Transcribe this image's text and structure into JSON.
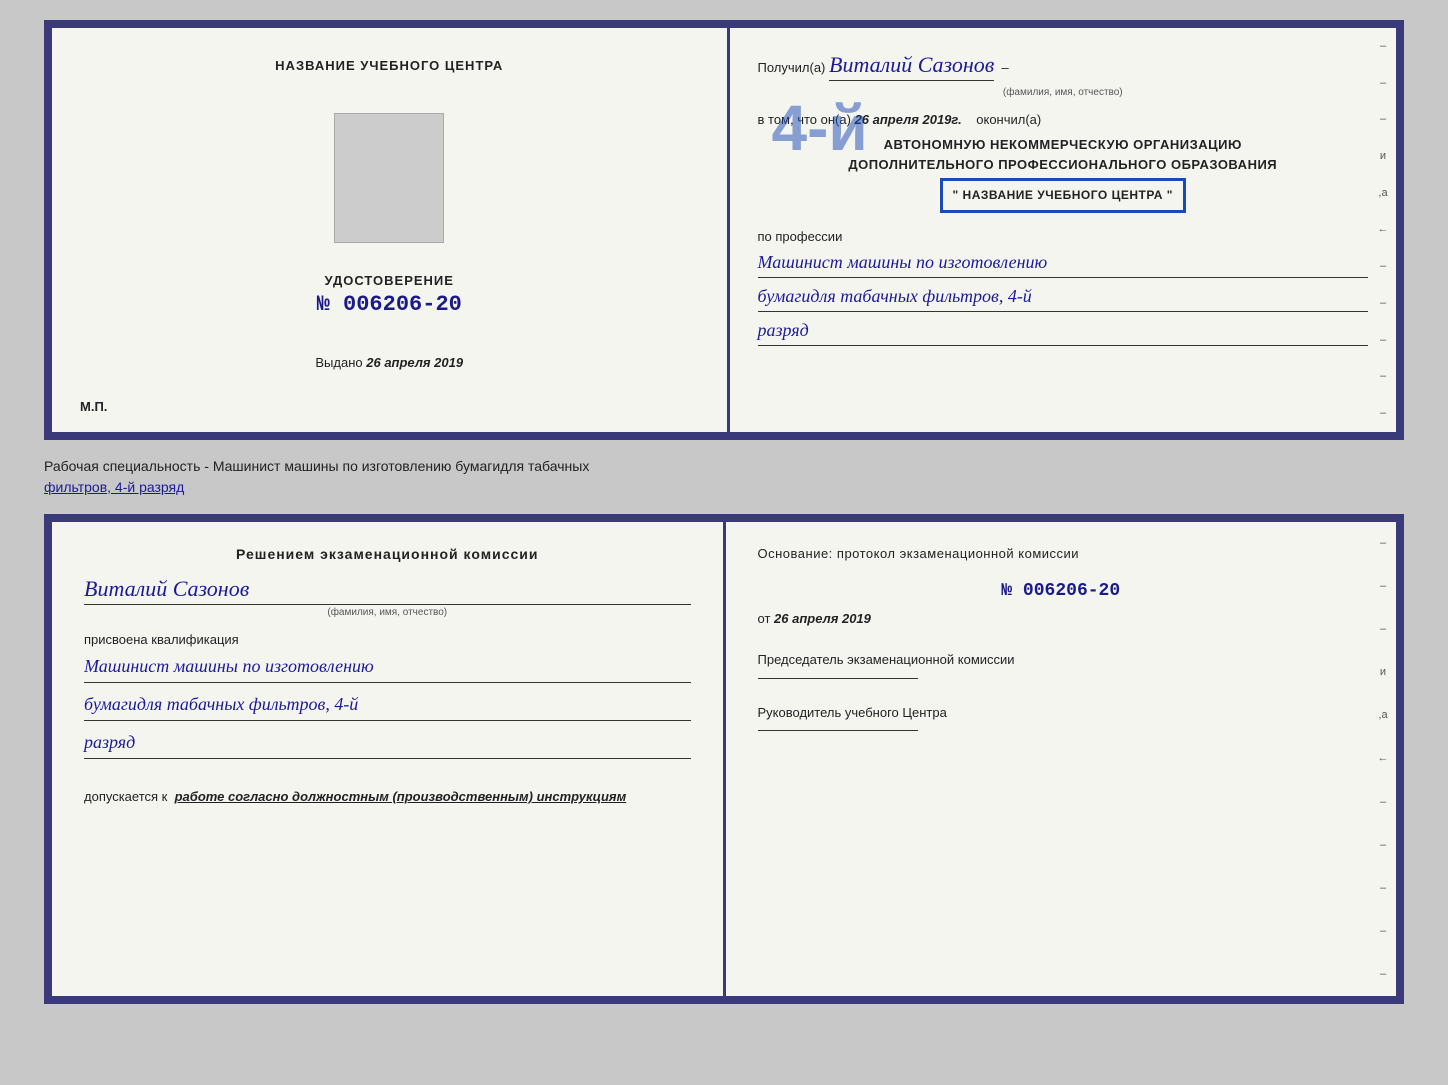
{
  "top_left": {
    "center_title": "НАЗВАНИЕ УЧЕБНОГО ЦЕНТРА",
    "udost_label": "УДОСТОВЕРЕНИЕ",
    "udost_number": "№ 006206-20",
    "vydano_prefix": "Выдано",
    "vydano_date": "26 апреля 2019",
    "mp_label": "М.П."
  },
  "top_right": {
    "poluchil_prefix": "Получил(а)",
    "poluchil_name": "Виталий Сазонов",
    "fio_hint": "(фамилия, имя, отчество)",
    "vtom_prefix": "в том, что он(а)",
    "vtom_date": "26 апреля 2019г.",
    "okonchil": "окончил(а)",
    "big_number": "4-й",
    "org_line1": "АВТОНОМНУЮ НЕКОММЕРЧЕСКУЮ ОРГАНИЗАЦИЮ",
    "org_line2": "ДОПОЛНИТЕЛЬНОГО ПРОФЕССИОНАЛЬНОГО ОБРАЗОВАНИЯ",
    "stamp_title": "\" НАЗВАНИЕ УЧЕБНОГО ЦЕНТРА \"",
    "po_professii": "по профессии",
    "profession_line1": "Машинист машины по изготовлению",
    "profession_line2": "бумагидля табачных фильтров, 4-й",
    "profession_line3": "разряд"
  },
  "between_label": {
    "prefix": "Рабочая специальность - Машинист машины по изготовлению бумагидля табачных",
    "underline": "фильтров, 4-й разряд"
  },
  "bottom_left": {
    "resheniem_title": "Решением экзаменационной комиссии",
    "person_name": "Виталий Сазонов",
    "fio_hint": "(фамилия, имя, отчество)",
    "prisvoena": "присвоена квалификация",
    "qual_line1": "Машинист машины по изготовлению",
    "qual_line2": "бумагидля табачных фильтров, 4-й",
    "qual_line3": "разряд",
    "dopusk_prefix": "допускается к",
    "dopusk_italic": "работе согласно должностным (производственным) инструкциям"
  },
  "bottom_right": {
    "osnovanie": "Основание: протокол экзаменационной комиссии",
    "protocol_number": "№ 006206-20",
    "ot_prefix": "от",
    "ot_date": "26 апреля 2019",
    "predsedatel_label": "Председатель экзаменационной комиссии",
    "rukovoditel_label": "Руководитель учебного Центра"
  },
  "right_dashes": [
    "-",
    "-",
    "-",
    "и",
    ",а",
    "←",
    "-",
    "-",
    "-",
    "-",
    "-"
  ]
}
